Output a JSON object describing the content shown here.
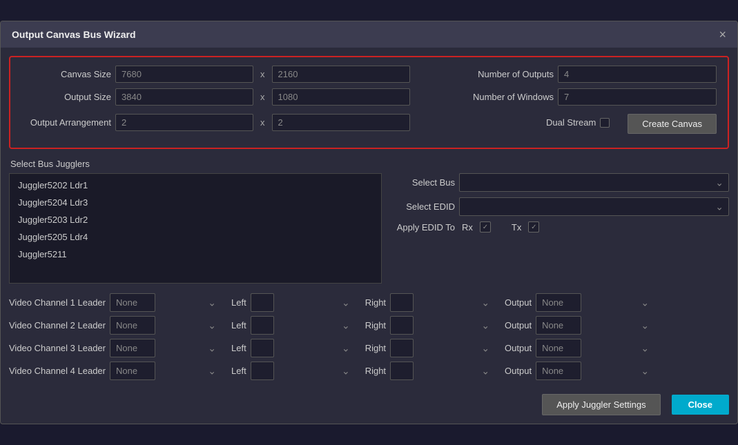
{
  "dialog": {
    "title": "Output Canvas Bus Wizard",
    "close_icon": "×"
  },
  "config": {
    "canvas_size_label": "Canvas Size",
    "canvas_width": "7680",
    "canvas_height": "2160",
    "output_size_label": "Output Size",
    "output_width": "3840",
    "output_height": "1080",
    "output_arrangement_label": "Output Arrangement",
    "arrangement_x": "2",
    "arrangement_y": "2",
    "num_outputs_label": "Number of Outputs",
    "num_outputs": "4",
    "num_windows_label": "Number of Windows",
    "num_windows": "7",
    "dual_stream_label": "Dual Stream",
    "create_canvas_label": "Create Canvas",
    "x_separator": "x"
  },
  "jugglers": {
    "section_title": "Select Bus Jugglers",
    "items": [
      "Juggler5202 Ldr1",
      "Juggler5204 Ldr3",
      "Juggler5203 Ldr2",
      "Juggler5205 Ldr4",
      "Juggler5211"
    ]
  },
  "bus_controls": {
    "select_bus_label": "Select Bus",
    "select_edid_label": "Select EDID",
    "apply_edid_label": "Apply EDID To",
    "rx_label": "Rx",
    "tx_label": "Tx"
  },
  "channels": [
    {
      "label": "Video Channel 1 Leader",
      "value": "None",
      "left_value": "",
      "right_value": "",
      "output_value": "None"
    },
    {
      "label": "Video Channel 2 Leader",
      "value": "None",
      "left_value": "",
      "right_value": "",
      "output_value": "None"
    },
    {
      "label": "Video Channel 3 Leader",
      "value": "None",
      "left_value": "",
      "right_value": "",
      "output_value": "None"
    },
    {
      "label": "Video Channel 4 Leader",
      "value": "None",
      "left_value": "",
      "right_value": "",
      "output_value": "None"
    }
  ],
  "buttons": {
    "apply_juggler": "Apply Juggler Settings",
    "close": "Close"
  },
  "labels": {
    "left": "Left",
    "right": "Right",
    "output": "Output"
  }
}
